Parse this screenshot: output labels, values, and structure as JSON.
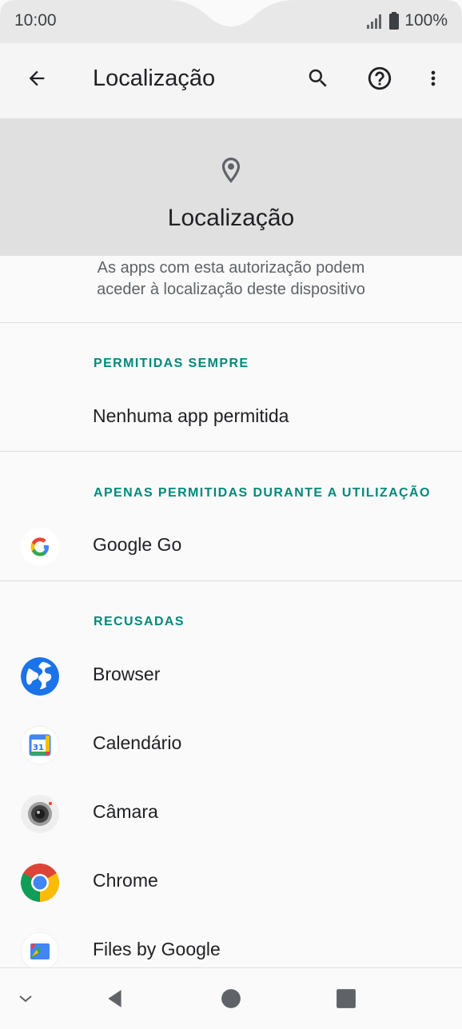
{
  "status": {
    "time": "10:00",
    "battery": "100%"
  },
  "toolbar": {
    "title": "Localização"
  },
  "header": {
    "title": "Localização",
    "description_line1": "As apps com esta autorização podem",
    "description_line2": "aceder à localização deste dispositivo"
  },
  "sections": {
    "always": {
      "title": "PERMITIDAS SEMPRE",
      "empty": "Nenhuma app permitida"
    },
    "in_use": {
      "title": "APENAS PERMITIDAS DURANTE A UTILIZAÇÃO",
      "apps": [
        "Google Go"
      ]
    },
    "denied": {
      "title": "RECUSADAS",
      "apps": [
        "Browser",
        "Calendário",
        "Câmara",
        "Chrome",
        "Files by Google"
      ]
    }
  },
  "icons": {
    "back": "arrow-back-icon",
    "search": "search-icon",
    "help": "help-icon",
    "more": "more-vert-icon",
    "location": "location-pin-icon"
  },
  "colors": {
    "accent": "#00897b",
    "banner": "#e0e0e0"
  }
}
